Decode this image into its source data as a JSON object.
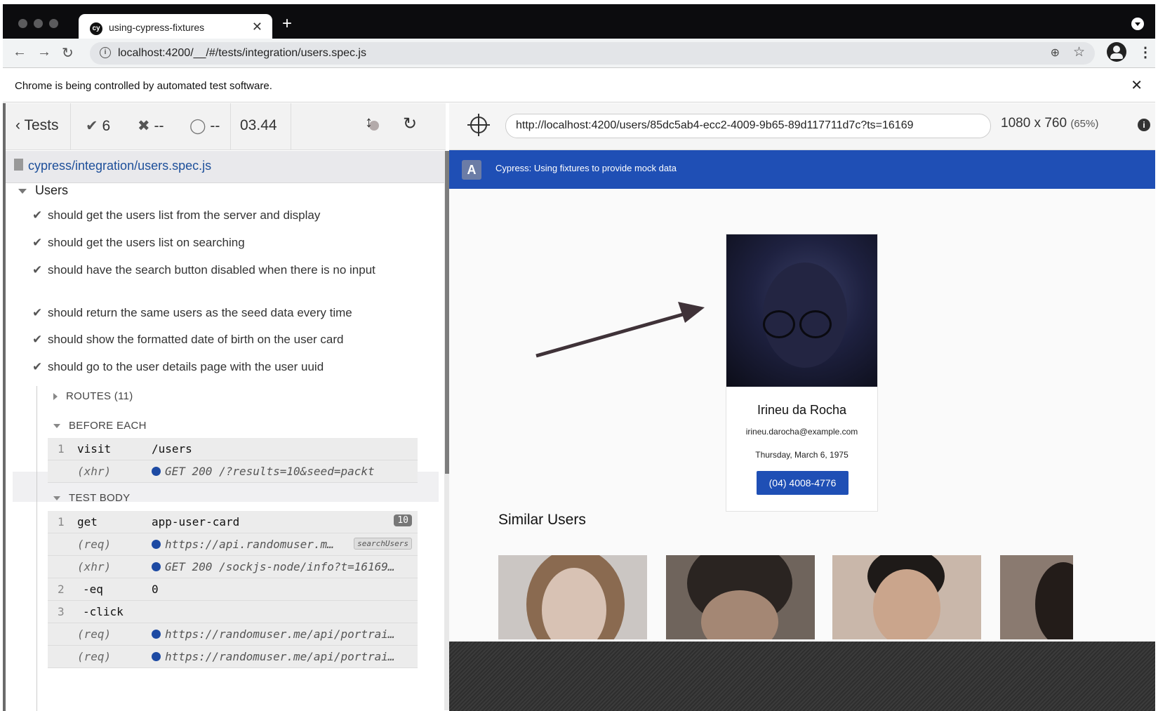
{
  "browser": {
    "tab_title": "using-cypress-fixtures",
    "favicon_text": "cy",
    "url": "localhost:4200/__/#/tests/integration/users.spec.js",
    "infobar_message": "Chrome is being controlled by automated test software."
  },
  "reporter": {
    "back_label": "Tests",
    "passed": "6",
    "failed": "--",
    "pending": "--",
    "duration": "03.44",
    "spec_path": "cypress/integration/users.spec.js",
    "suite": "Users",
    "tests": [
      "should get the users list from the server and display",
      "should get the users list on searching",
      "should have the search button disabled when there is no input",
      "should return the same users as the seed data every time",
      "should show the formatted date of birth on the user card",
      "should go to the user details page with the user uuid"
    ],
    "routes_label": "ROUTES (11)",
    "before_each_label": "BEFORE EACH",
    "test_body_label": "TEST BODY",
    "before_each_commands": [
      {
        "num": "1",
        "name": "visit",
        "message": "/users"
      },
      {
        "num": "",
        "name": "(xhr)",
        "message": "GET 200 /?results=10&seed=packt"
      }
    ],
    "test_body_commands": [
      {
        "num": "1",
        "name": "get",
        "message": "app-user-card",
        "badge": "10"
      },
      {
        "num": "",
        "name": "(req)",
        "message": "https://api.randomuser.m…",
        "alias": "searchUsers"
      },
      {
        "num": "",
        "name": "(xhr)",
        "message": "GET 200 /sockjs-node/info?t=16169…"
      },
      {
        "num": "2",
        "name": "-eq",
        "message": "0"
      },
      {
        "num": "3",
        "name": "-click",
        "message": ""
      },
      {
        "num": "",
        "name": "(req)",
        "message": "https://randomuser.me/api/portrai…"
      },
      {
        "num": "",
        "name": "(req)",
        "message": "https://randomuser.me/api/portrai…"
      }
    ]
  },
  "runner": {
    "url": "http://localhost:4200/users/85dc5ab4-ecc2-4009-9b65-89d117711d7c?ts=16169",
    "viewport": "1080 x 760",
    "scale": "(65%)"
  },
  "app": {
    "logo": "A",
    "title": "Cypress: Using fixtures to provide mock data",
    "user": {
      "name": "Irineu da Rocha",
      "email": "irineu.darocha@example.com",
      "dob": "Thursday, March 6, 1975",
      "phone": "(04) 4008-4776"
    },
    "similar_title": "Similar Users"
  },
  "colors": {
    "accent": "#1f4fb5",
    "link": "#1d4f9a",
    "dot": "#1d4aa3"
  },
  "icons": [
    "back-icon",
    "forward-icon",
    "reload-icon",
    "info-icon",
    "zoom-icon",
    "star-icon",
    "account-icon",
    "menu-icon",
    "check-icon",
    "fail-icon",
    "pending-icon",
    "stop-icon",
    "refresh-icon",
    "selector-icon"
  ]
}
